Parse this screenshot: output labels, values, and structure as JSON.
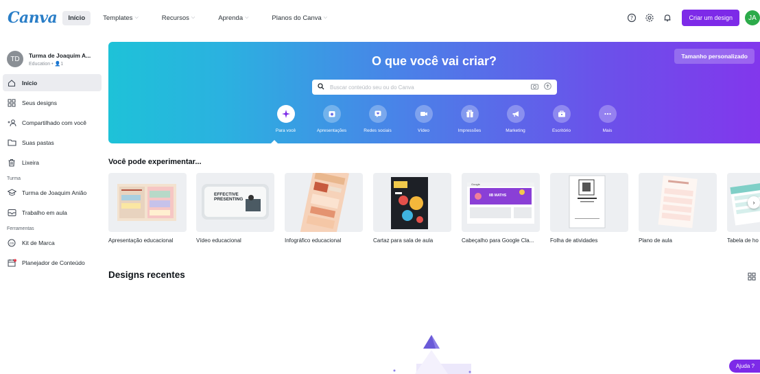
{
  "nav": {
    "logo": "Canva",
    "items": [
      {
        "label": "Início",
        "active": true,
        "dropdown": false
      },
      {
        "label": "Templates",
        "active": false,
        "dropdown": true
      },
      {
        "label": "Recursos",
        "active": false,
        "dropdown": true
      },
      {
        "label": "Aprenda",
        "active": false,
        "dropdown": true
      },
      {
        "label": "Planos do Canva",
        "active": false,
        "dropdown": true
      }
    ],
    "create_label": "Criar um design",
    "avatar": "JA",
    "icons": [
      "help-icon",
      "settings-icon",
      "bell-icon"
    ]
  },
  "sidebar": {
    "team_avatar": "TD",
    "team_name": "Turma de Joaquim A...",
    "team_sub": "Education • 👤1",
    "items": [
      {
        "label": "Início",
        "icon": "home-icon",
        "active": true
      },
      {
        "label": "Seus designs",
        "icon": "grid-icon",
        "active": false
      },
      {
        "label": "Compartilhado com você",
        "icon": "shared-users-icon",
        "active": false
      },
      {
        "label": "Suas pastas",
        "icon": "folder-icon",
        "active": false
      },
      {
        "label": "Lixeira",
        "icon": "trash-icon",
        "active": false
      }
    ],
    "section_turma": "Turma",
    "turma_items": [
      {
        "label": "Turma de Joaquim Anião",
        "icon": "graduation-cap-icon"
      },
      {
        "label": "Trabalho em aula",
        "icon": "assignment-icon"
      }
    ],
    "section_tools": "Ferramentas",
    "tool_items": [
      {
        "label": "Kit de Marca",
        "icon": "brand-kit-icon"
      },
      {
        "label": "Planejador de Conteúdo",
        "icon": "calendar-icon"
      }
    ]
  },
  "hero": {
    "title": "O que você vai criar?",
    "custom_size": "Tamanho personalizado",
    "search_placeholder": "Buscar conteúdo seu ou do Canva",
    "categories": [
      {
        "label": "Para você",
        "icon": "sparkle-icon",
        "active": true
      },
      {
        "label": "Apresentações",
        "icon": "presentation-icon",
        "active": false
      },
      {
        "label": "Redes sociais",
        "icon": "heart-chat-icon",
        "active": false
      },
      {
        "label": "Vídeo",
        "icon": "video-icon",
        "active": false
      },
      {
        "label": "Impressões",
        "icon": "gift-icon",
        "active": false
      },
      {
        "label": "Marketing",
        "icon": "megaphone-icon",
        "active": false
      },
      {
        "label": "Escritório",
        "icon": "briefcase-icon",
        "active": false
      },
      {
        "label": "Mais",
        "icon": "more-icon",
        "active": false
      }
    ]
  },
  "suggestions": {
    "title": "Você pode experimentar...",
    "cards": [
      {
        "label": "Apresentação educacional"
      },
      {
        "label": "Vídeo educacional"
      },
      {
        "label": "Infográfico educacional"
      },
      {
        "label": "Cartaz para sala de aula"
      },
      {
        "label": "Cabeçalho para Google Cla..."
      },
      {
        "label": "Folha de atividades"
      },
      {
        "label": "Plano de aula"
      },
      {
        "label": "Tabela de ho"
      }
    ],
    "thumb_texts": {
      "presenting": "EFFECTIVE PRESENTING",
      "google": "Google",
      "maths": "8B MATHS"
    }
  },
  "recent": {
    "title": "Designs recentes"
  },
  "help": {
    "label": "Ajuda ?"
  }
}
